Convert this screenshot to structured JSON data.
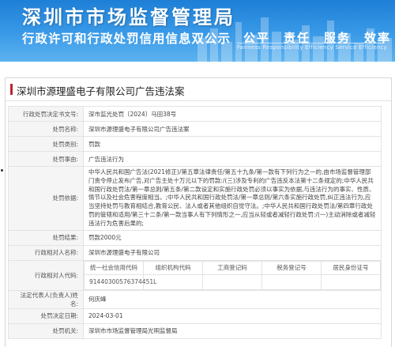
{
  "banner": {
    "title": "深圳市市场监督管理局",
    "subtitle": "行政许可和行政处罚信用信息双公示",
    "slogan": "公平　责任　服务　效率",
    "slogan_en": "Fairness  Responsibility  Efficiency  Service  Efficiency"
  },
  "page": {
    "title": "深圳市源理盛电子有限公司广告违法案"
  },
  "record": {
    "decision_no": {
      "label": "行政处罚决定书文号:",
      "value": "深市监光处罚〔2024〕马田38号"
    },
    "case_name": {
      "label": "处罚名称:",
      "value": "深圳市源理盛电子有限公司广告违法案"
    },
    "category": {
      "label": "处罚类别:",
      "value": "罚款"
    },
    "cause": {
      "label": "处罚事由:",
      "value": "广告违法行为"
    },
    "basis": {
      "label": "处罚依据:",
      "value": "中华人民共和国广告法(2021修正)/第五章法律责任/第五十九条/第一款有下列行为之一的,由市场监督管理部门责令停止发布广告,对广告主处十万元以下的罚款:/(三)涉及专利的广告违反本法第十二条规定的;中华人民共和国行政处罚法/第一章总则/第五条/第二款设定和实施行政处罚必须以事实为依据,与违法行为的事实、性质、情节以及社会危害程度相当。;中华人民共和国行政处罚法/第一章总则/第六条实施行政处罚,纠正违法行为,应当坚持处罚与教育相结合,教育公民、法人或者其他组织自觉守法。;中华人民共和国行政处罚法/第四章行政处罚的管辖和适用/第三十二条/第一款当事人有下列情形之一,应当从轻或者减轻行政处罚:/(一)主动消除或者减轻违法行为危害后果的;"
    },
    "result": {
      "label": "处罚结果:",
      "value": "罚款2000元"
    },
    "party": {
      "label": "行政相对人名称:",
      "value": "深圳市源理盛电子有限公司"
    },
    "codes": {
      "label": "行政相对人代码:",
      "headers": [
        "统一社会信用代码",
        "组织机构代码",
        "工商登记码",
        "税务登记号",
        "居民身份证号"
      ],
      "values": [
        "91440300576374451L",
        "",
        "",
        "",
        ""
      ]
    },
    "legal_rep": {
      "label": "法定代表人(负责人)姓名:",
      "value": "何庆峰"
    },
    "decision_date": {
      "label": "处罚决定日期:",
      "value": "2024-03-01"
    },
    "authority": {
      "label": "处罚机关:",
      "value": "深圳市市场监督管理局光明监督局"
    }
  }
}
